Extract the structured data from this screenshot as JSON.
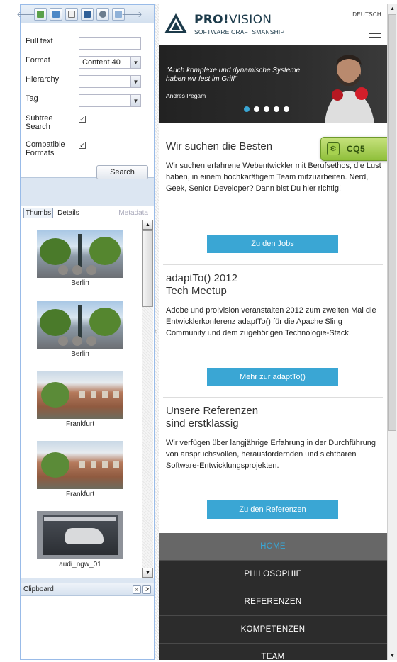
{
  "sidekick": {
    "toolbar": {
      "icons": [
        "back-icon",
        "page-icon",
        "component-icon",
        "document-icon",
        "workflow-icon",
        "versioning-icon",
        "tools-icon"
      ],
      "back_glyph": "🡐",
      "more_glyph": "🡒"
    },
    "form": {
      "full_text_label": "Full text",
      "full_text_value": "",
      "format_label": "Format",
      "format_value": "Content 40",
      "hierarchy_label": "Hierarchy",
      "hierarchy_value": "",
      "tag_label": "Tag",
      "tag_value": "",
      "subtree_label_1": "Subtree",
      "subtree_label_2": "Search",
      "subtree_checked": "✓",
      "compatible_label_1": "Compatible",
      "compatible_label_2": "Formats",
      "compatible_checked": "✓",
      "search_button": "Search"
    },
    "tabs": {
      "thumbs": "Thumbs",
      "details": "Details",
      "metadata": "Metadata"
    },
    "thumbs": [
      {
        "caption": "Berlin"
      },
      {
        "caption": "Berlin"
      },
      {
        "caption": "Frankfurt"
      },
      {
        "caption": "Frankfurt"
      },
      {
        "caption": "audi_ngw_01"
      }
    ],
    "clipboard": {
      "title": "Clipboard"
    }
  },
  "site": {
    "logo": {
      "brand_bold": "PRO!",
      "brand_thin": "VISION",
      "tagline": "SOFTWARE CRAFTSMANSHIP"
    },
    "language": "DEUTSCH",
    "hero": {
      "quote": "\"Auch komplexe und dynamische Systeme haben wir fest im Griff\"",
      "person": "Andres Pegam",
      "slides": 5,
      "active_slide": 1
    },
    "sections": [
      {
        "title": "Wir suchen die Besten",
        "text": "Wir suchen erfahrene Webentwickler mit Berufsethos, die Lust haben, in einem hochkarätigem Team mitzuarbeiten. Nerd, Geek, Senior Developer? Dann bist Du hier richtig!",
        "button": "Zu den Jobs"
      },
      {
        "title": "adaptTo() 2012\nTech Meetup",
        "text": "Adobe und pro!vision veranstalten 2012 zum zweiten Mal die Entwicklerkonferenz adaptTo() für die Apache Sling Community und dem zugehörigen Technologie-Stack.",
        "button": "Mehr zur adaptTo()"
      },
      {
        "title": "Unsere Referenzen\nsind erstklassig",
        "text": "Wir verfügen über langjährige Erfahrung in der Durchführung von anspruchsvollen, herausfordernden und sichtbaren Software-Entwicklungsprojekten.",
        "button": "Zu den Referenzen"
      }
    ],
    "nav": [
      "HOME",
      "PHILOSOPHIE",
      "REFERENZEN",
      "KOMPETENZEN",
      "TEAM"
    ],
    "cq5_badge": "CQ5",
    "colors": {
      "accent": "#3aa6d4",
      "nav_bg": "#2c2c2c",
      "nav_active_bg": "#676767",
      "cq5_green": "#9ccb44"
    }
  }
}
